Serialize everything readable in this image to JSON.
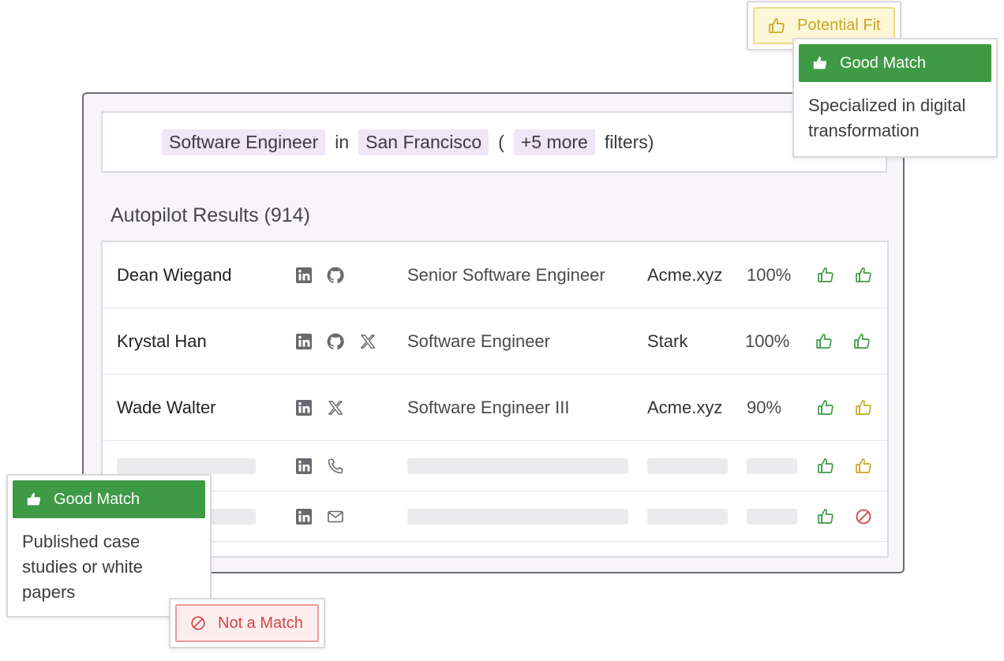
{
  "search": {
    "role": "Software Engineer",
    "in_word": "in",
    "location": "San Francisco",
    "open_paren": "(",
    "more": "+5 more",
    "filters_word": "filters)"
  },
  "results": {
    "title": "Autopilot Results (914)"
  },
  "rows": [
    {
      "name": "Dean Wiegand",
      "title": "Senior Software Engineer",
      "company": "Acme.xyz",
      "score": "100%",
      "socials": [
        "linkedin-icon",
        "github-icon"
      ],
      "ratings": [
        "good",
        "good"
      ]
    },
    {
      "name": "Krystal Han",
      "title": "Software Engineer",
      "company": "Stark",
      "score": "100%",
      "socials": [
        "linkedin-icon",
        "github-icon",
        "x-icon"
      ],
      "ratings": [
        "good",
        "good"
      ]
    },
    {
      "name": "Wade Walter",
      "title": "Software Engineer III",
      "company": "Acme.xyz",
      "score": "90%",
      "socials": [
        "linkedin-icon",
        "x-icon"
      ],
      "ratings": [
        "good",
        "potential"
      ]
    },
    {
      "name": "",
      "socials": [
        "linkedin-icon",
        "phone-icon"
      ],
      "ratings": [
        "good",
        "potential"
      ]
    },
    {
      "name": "",
      "socials": [
        "linkedin-icon",
        "mail-icon"
      ],
      "ratings": [
        "good",
        "not-a-match"
      ]
    }
  ],
  "cards": {
    "potential_fit": "Potential Fit",
    "good_match_top": {
      "label": "Good Match",
      "text": "Specialized in digital transformation"
    },
    "good_match_bottom": {
      "label": "Good Match",
      "text": "Published case studies or white papers"
    },
    "not_a_match": "Not a Match"
  },
  "colors": {
    "good": "#3e9a44",
    "potential": "#c7a823",
    "not_match": "#d24444",
    "chip_bg": "#efe6f6"
  }
}
